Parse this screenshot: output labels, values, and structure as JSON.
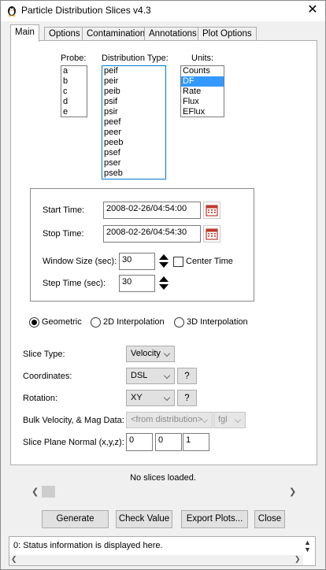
{
  "window": {
    "title": "Particle Distribution Slices v4.3",
    "close_glyph": "✕"
  },
  "tabs": [
    "Main",
    "Options",
    "Contamination",
    "Annotations",
    "Plot Options"
  ],
  "probe": {
    "label": "Probe:",
    "items": [
      "a",
      "b",
      "c",
      "d",
      "e"
    ]
  },
  "distribution": {
    "label": "Distribution Type:",
    "items": [
      "peif",
      "peir",
      "peib",
      "psif",
      "psir",
      "peef",
      "peer",
      "peeb",
      "psef",
      "pser",
      "pseb"
    ]
  },
  "units": {
    "label": "Units:",
    "items": [
      "Counts",
      "DF",
      "Rate",
      "Flux",
      "EFlux"
    ],
    "selected": "DF"
  },
  "times": {
    "start_label": "Start Time:",
    "start_value": "2008-02-26/04:54:00",
    "stop_label": "Stop Time:",
    "stop_value": "2008-02-26/04:54:30",
    "window_label": "Window Size (sec):",
    "window_value": "30",
    "center_label": "Center Time",
    "step_label": "Step Time (sec):",
    "step_value": "30"
  },
  "method": {
    "geometric": "Geometric",
    "interp2d": "2D Interpolation",
    "interp3d": "3D Interpolation",
    "selected": "Geometric"
  },
  "slice_type": {
    "label": "Slice Type:",
    "value": "Velocity"
  },
  "coordinates": {
    "label": "Coordinates:",
    "value": "DSL",
    "help": "?"
  },
  "rotation": {
    "label": "Rotation:",
    "value": "XY",
    "help": "?"
  },
  "bulk": {
    "label": "Bulk Velocity, & Mag Data:",
    "velocity_value": "<from distribution>",
    "mag_value": "fgl"
  },
  "normal": {
    "label": "Slice Plane Normal (x,y,z):",
    "x": "0",
    "y": "0",
    "z": "1"
  },
  "slider_status": "No slices loaded.",
  "buttons": {
    "generate": "Generate",
    "check": "Check Value",
    "export": "Export Plots...",
    "close": "Close"
  },
  "status": "0: Status information is displayed here.",
  "colors": {
    "selection": "#3399ff",
    "calendar": "#c0392b"
  },
  "icons": {
    "app": "penguin-icon",
    "calendar": "calendar-icon"
  }
}
